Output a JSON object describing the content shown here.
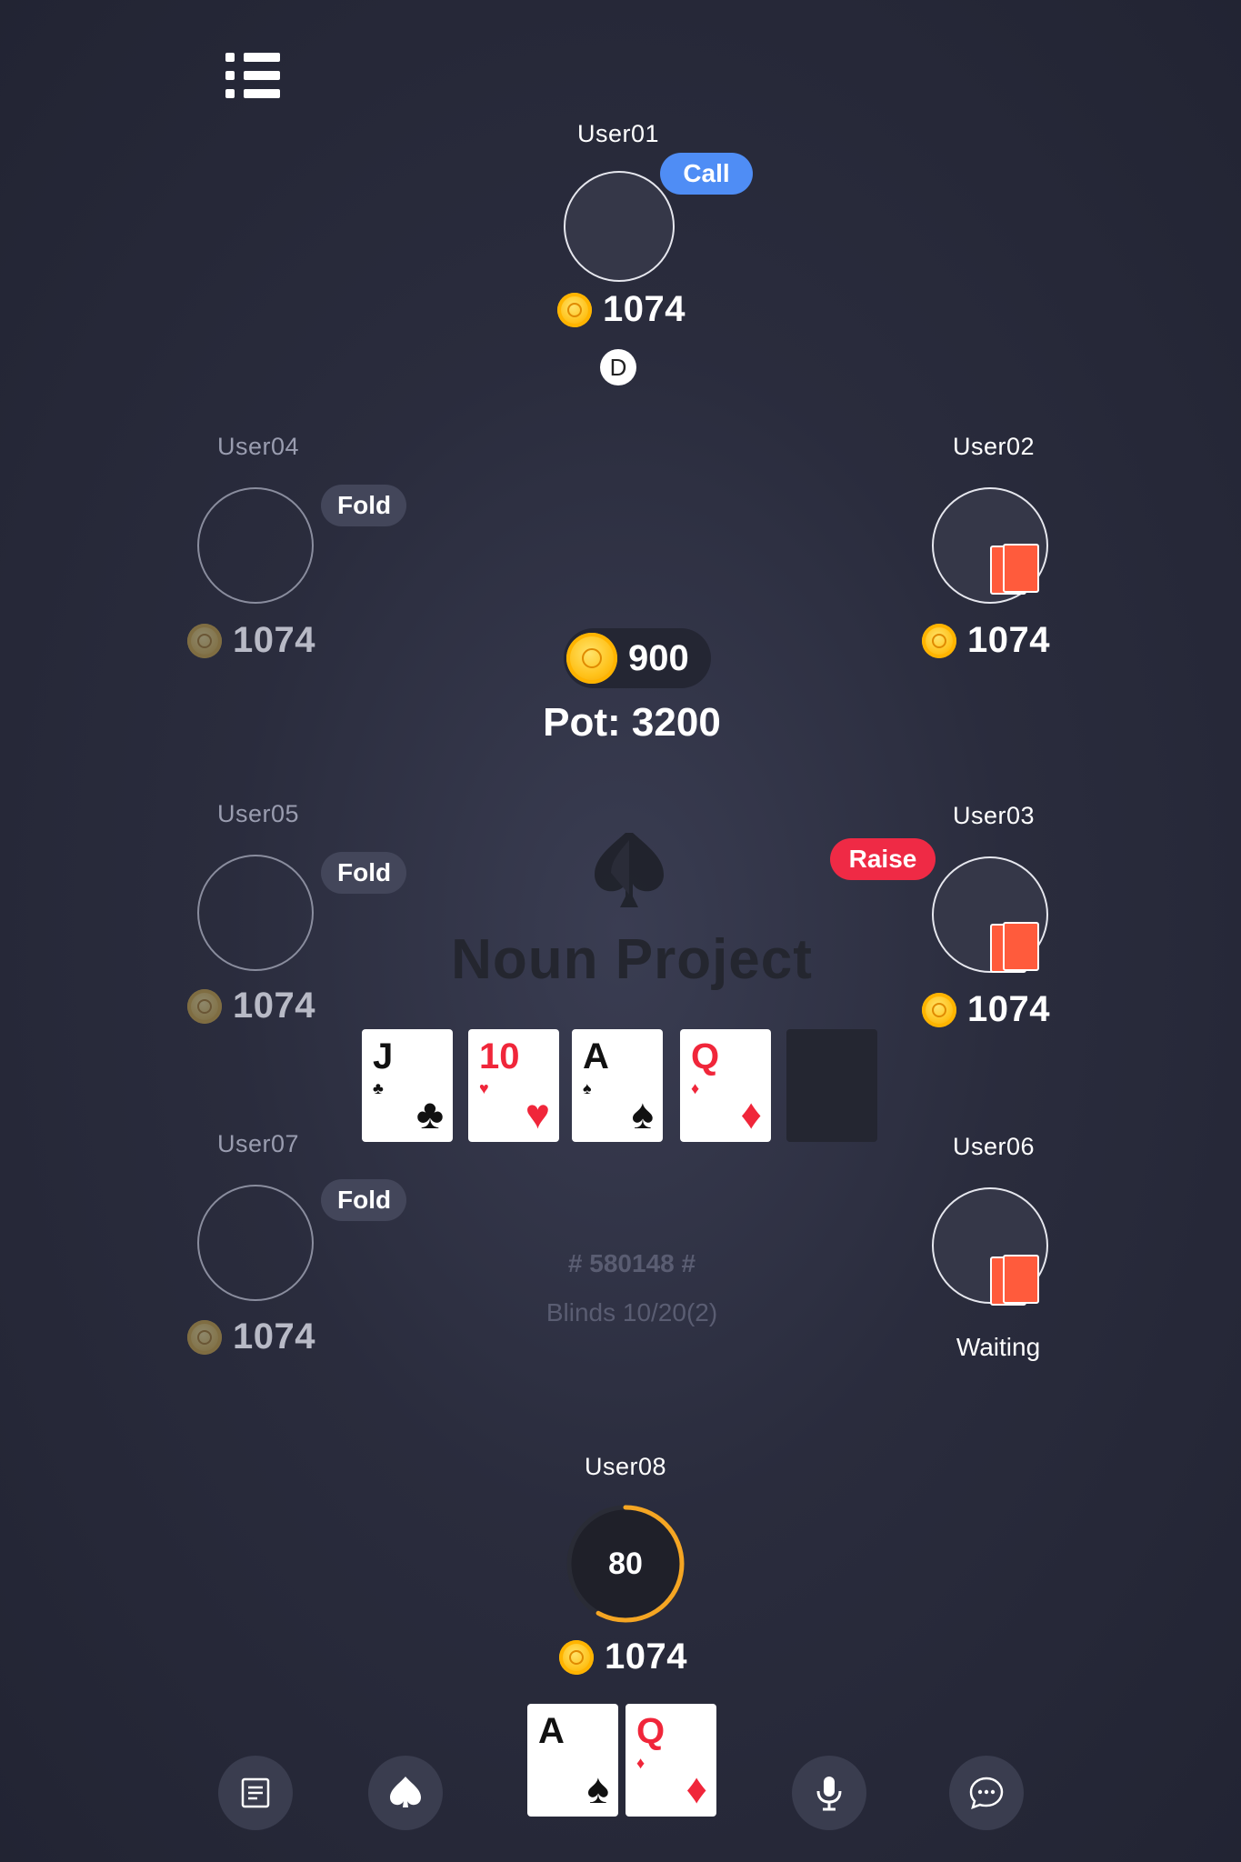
{
  "menu": {
    "icon": "menu-list-icon"
  },
  "players": {
    "user01": {
      "name": "User01",
      "chips": "1074",
      "action": "Call"
    },
    "user02": {
      "name": "User02",
      "chips": "1074"
    },
    "user03": {
      "name": "User03",
      "chips": "1074",
      "action": "Raise"
    },
    "user04": {
      "name": "User04",
      "chips": "1074",
      "action": "Fold"
    },
    "user05": {
      "name": "User05",
      "chips": "1074",
      "action": "Fold"
    },
    "user06": {
      "name": "User06",
      "status": "Waiting"
    },
    "user07": {
      "name": "User07",
      "chips": "1074",
      "action": "Fold"
    },
    "user08": {
      "name": "User08",
      "chips": "1074",
      "timer": "80",
      "timer_progress": 0.42
    }
  },
  "dealer_button": "D",
  "table": {
    "bet": "900",
    "pot_label": "Pot: 3200",
    "watermark": "Noun Project",
    "game_id": "# 580148 #",
    "blinds": "Blinds 10/20(2)"
  },
  "community_cards": [
    {
      "rank": "J",
      "suit": "♣",
      "color": "#111111"
    },
    {
      "rank": "10",
      "suit": "♥",
      "color": "#f0263a"
    },
    {
      "rank": "A",
      "suit": "♠",
      "color": "#111111"
    },
    {
      "rank": "Q",
      "suit": "♦",
      "color": "#f0263a"
    }
  ],
  "hand_cards": [
    {
      "rank": "A",
      "suit": "♠",
      "color": "#111111"
    },
    {
      "rank": "Q",
      "suit": "♦",
      "color": "#f0263a"
    }
  ],
  "toolbar": {
    "history_icon": "document-icon",
    "spade_icon": "spade-icon",
    "mic_icon": "microphone-icon",
    "chat_icon": "chat-bubble-icon"
  },
  "colors": {
    "call": "#4f8df5",
    "raise": "#ef2a45",
    "fold": "#43465a",
    "card_back": "#ff5b3c",
    "timer": "#f5a623"
  }
}
